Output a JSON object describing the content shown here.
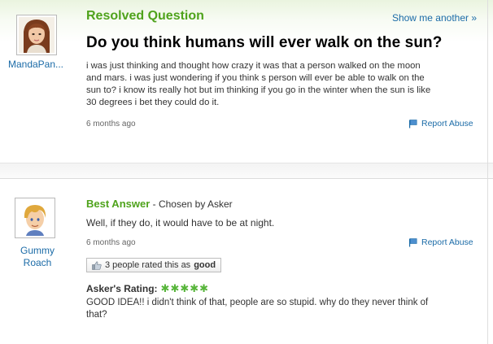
{
  "question": {
    "user": {
      "name": "MandaPan..."
    },
    "status_label": "Resolved Question",
    "show_another": "Show me another »",
    "title": "Do you think humans will ever walk on the sun?",
    "body_lines": [
      "i was just thinking and thought how crazy it was that a person walked on the moon",
      "and mars. i was just wondering if you think s person will ever be able to walk on the",
      "sun to? i know its really hot but im thinking if you go in the winter when the sun is like",
      "30 degrees i bet they could do it."
    ],
    "timestamp": "6 months ago",
    "report_abuse": "Report Abuse"
  },
  "answer": {
    "user": {
      "name_line1": "Gummy",
      "name_line2": "Roach"
    },
    "best_answer_label": "Best Answer",
    "chosen_by": " - Chosen by Asker",
    "text": "Well, if they do, it would have to be at night.",
    "timestamp": "6 months ago",
    "report_abuse": "Report Abuse",
    "rated_prefix": "3 people rated this as",
    "rated_value": "good",
    "askers_rating_label": "Asker's Rating:",
    "stars": "✱✱✱✱✱",
    "rating_value": 5,
    "comment_lines": [
      "GOOD IDEA!! i didn't think of that, people are so stupid. why do they never think of",
      "that?"
    ]
  },
  "colors": {
    "accent_green": "#4fa31c",
    "link_blue": "#1b6ba7",
    "star_green": "#57b53a"
  },
  "icons": {
    "flag": "report-flag-icon",
    "thumb": "thumbs-up-icon"
  }
}
